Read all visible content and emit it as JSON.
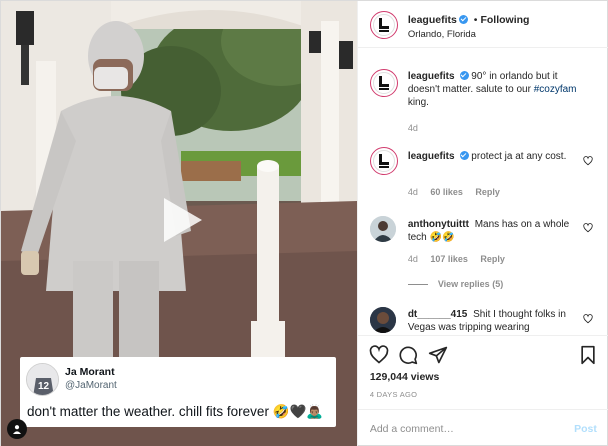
{
  "post": {
    "username": "leaguefits",
    "follow_separator": "•",
    "follow_status": "Following",
    "location": "Orlando, Florida"
  },
  "tweet": {
    "name": "Ja Morant",
    "handle": "@JaMorant",
    "text": "don't matter the weather. chill fits forever 🤣🖤🙇🏽‍♂️",
    "jersey_number": "12"
  },
  "comments": [
    {
      "username": "leaguefits",
      "text_before": "90° in orlando but it doesn't matter. salute to our ",
      "hashtag": "#cozyfam",
      "text_after": " king.",
      "time": "4d"
    },
    {
      "username": "leaguefits",
      "text": "protect ja at any cost.",
      "time": "4d",
      "likes": "60 likes",
      "reply": "Reply"
    },
    {
      "username": "anthonytuittt",
      "text": "Mans has on a whole tech 🤣🤣",
      "time": "4d",
      "likes": "107 likes",
      "reply": "Reply",
      "view_replies": "View replies (5)"
    },
    {
      "username": "dt______415",
      "text": "Shit I thought folks in Vegas was tripping wearing"
    }
  ],
  "stats": {
    "views": "129,044 views",
    "age": "4 DAYS AGO"
  },
  "composer": {
    "placeholder": "Add a comment…",
    "post_label": "Post"
  },
  "colors": {
    "verified": "#3897f0",
    "hashtag": "#00376b",
    "post_disabled": "#b2dffc",
    "story_ring": "#d13c6e"
  },
  "icons": [
    "play-icon",
    "user-tag-icon",
    "verified-icon",
    "more-options-icon",
    "heart-icon",
    "comment-icon",
    "share-icon",
    "save-icon"
  ]
}
